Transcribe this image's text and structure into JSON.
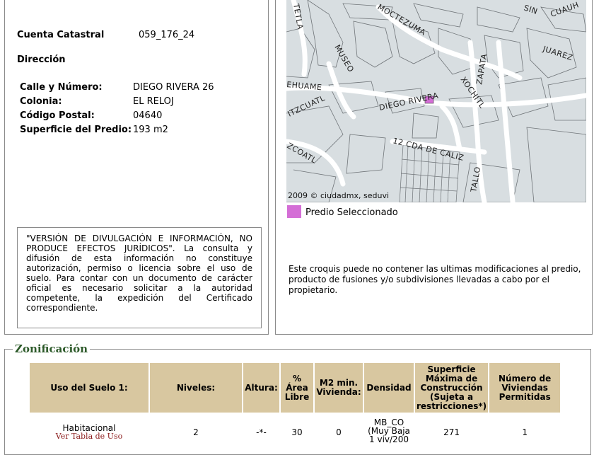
{
  "predio": {
    "cuenta_label": "Cuenta Catastral",
    "cuenta_value": "059_176_24",
    "direccion_label": "Dirección",
    "calle_label": "Calle y Número:",
    "calle_value": "DIEGO RIVERA 26",
    "colonia_label": "Colonia:",
    "colonia_value": "EL RELOJ",
    "cp_label": "Código Postal:",
    "cp_value": "04640",
    "superficie_label": "Superficie del Predio:",
    "superficie_value": "193 m2"
  },
  "disclaimer": "\"VERSIÓN DE DIVULGACIÓN E INFORMACIÓN, NO PRODUCE EFECTOS JURÍDICOS\". La consulta y difusión de esta información no constituye autorización, permiso o licencia sobre el uso de suelo. Para contar con un documento de carácter oficial es necesario solicitar a la autoridad competente, la expedición del Certificado correspondiente.",
  "map": {
    "streets": [
      "TETLA",
      "MOCTEZUMA",
      "SIN",
      "CUAUH",
      "JUAREZ",
      "MUSEO",
      "ZAPATA",
      "EHUAME",
      "XOCHITL",
      "DIEGO RIVERA",
      "ITZCUATL",
      "ZCOATL",
      "12 CDA DE CALIZ",
      "TALLO"
    ],
    "credit": "2009 © ciudadmx, seduvi",
    "legend_label": "Predio Seleccionado",
    "legend_color": "#d46ed6",
    "note": "Este croquis puede no contener las ultimas modificaciones al predio, producto de fusiones y/o subdivisiones llevadas a cabo por el propietario."
  },
  "zonificacion": {
    "title": "Zonificación",
    "headers": [
      "Uso del Suelo 1:",
      "Niveles:",
      "Altura:",
      "% Área Libre",
      "M2 min. Vivienda:",
      "Densidad",
      "Superficie Máxima de Construcción (Sujeta a restricciones*)",
      "Número de Viviendas Permitidas"
    ],
    "row": {
      "uso": "Habitacional",
      "uso_link": "Ver Tabla de Uso",
      "niveles": "2",
      "altura": "-*-",
      "area_libre": "30",
      "m2_min": "0",
      "densidad": "MB_CO (Muy Baja 1 viv/200",
      "superficie_max": "271",
      "num_viviendas": "1"
    }
  }
}
